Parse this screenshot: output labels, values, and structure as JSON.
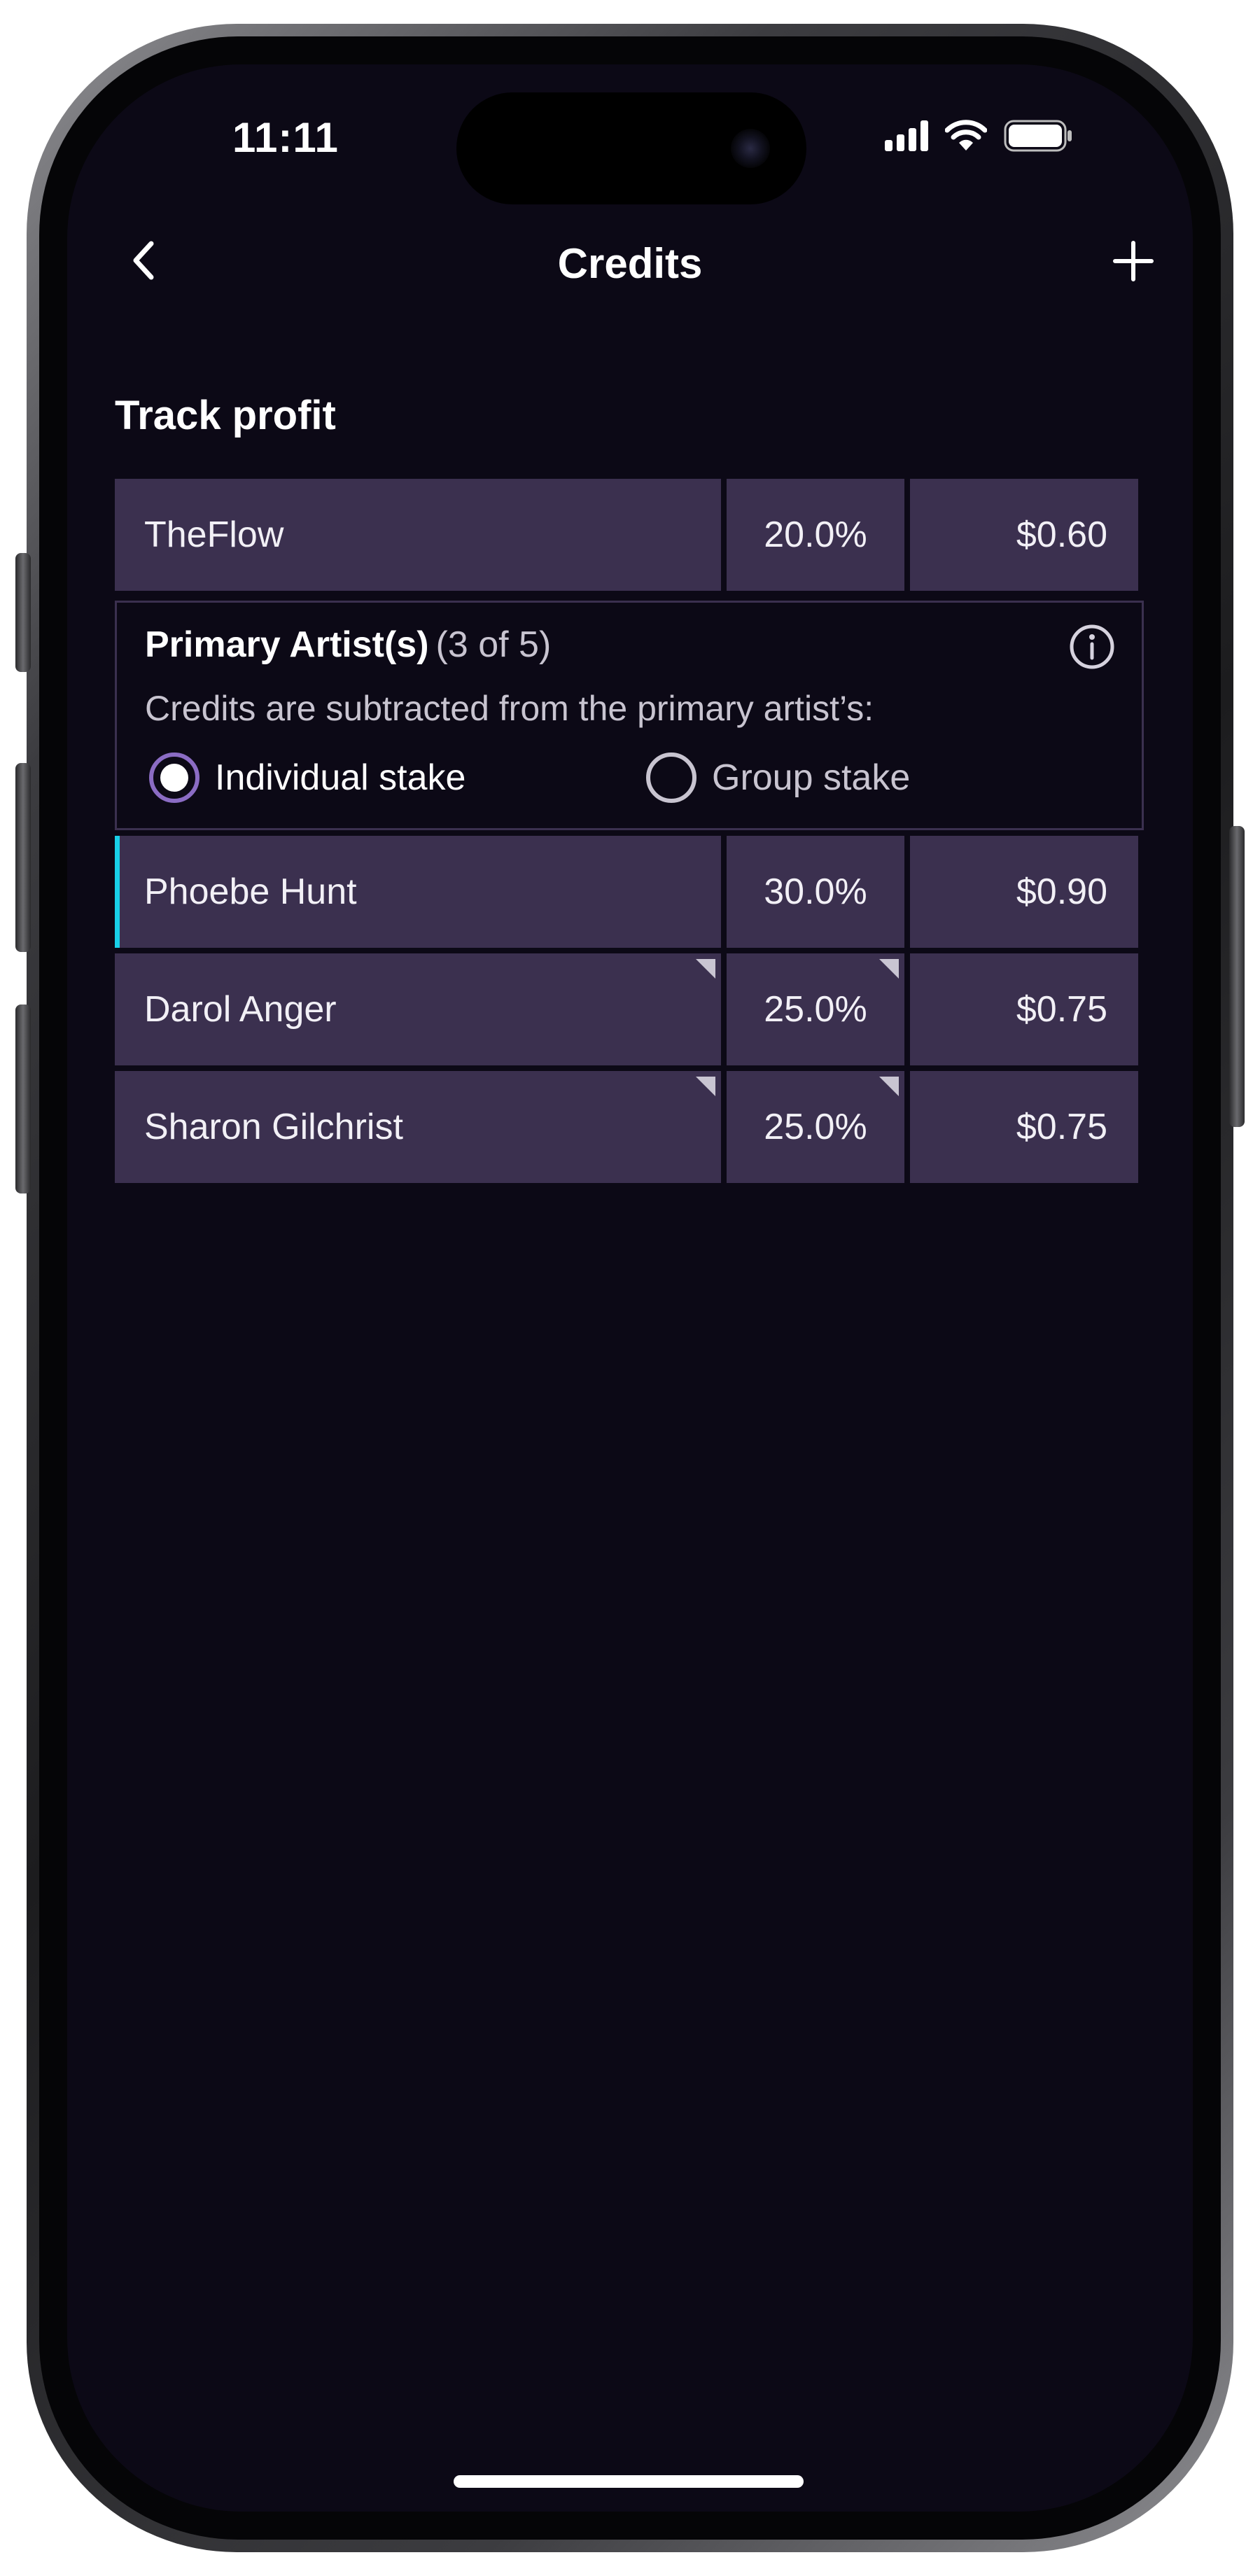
{
  "status_bar": {
    "time": "11:11",
    "icons": [
      "cellular-signal-icon",
      "wifi-icon",
      "battery-icon"
    ]
  },
  "header": {
    "back_icon": "chevron-left-icon",
    "title": "Credits",
    "add_icon": "plus-icon"
  },
  "section": {
    "title": "Track profit"
  },
  "owner_row": {
    "name": "TheFlow",
    "percent": "20.0%",
    "amount": "$0.60"
  },
  "primary": {
    "label": "Primary Artist(s)",
    "count": "(3 of 5)",
    "info_icon": "info-circle-icon",
    "description": "Credits are subtracted from the primary artist’s:",
    "options": [
      {
        "label": "Individual stake",
        "selected": true
      },
      {
        "label": "Group stake",
        "selected": false
      }
    ]
  },
  "artists": [
    {
      "name": "Phoebe Hunt",
      "percent": "30.0%",
      "amount": "$0.90",
      "selected": true
    },
    {
      "name": "Darol Anger",
      "percent": "25.0%",
      "amount": "$0.75",
      "selected": false
    },
    {
      "name": "Sharon Gilchrist",
      "percent": "25.0%",
      "amount": "$0.75",
      "selected": false
    }
  ],
  "colors": {
    "background": "#0c0916",
    "cell": "#3b304f",
    "selection_accent": "#18d0e8",
    "radio_accent": "#8b6cc4"
  }
}
